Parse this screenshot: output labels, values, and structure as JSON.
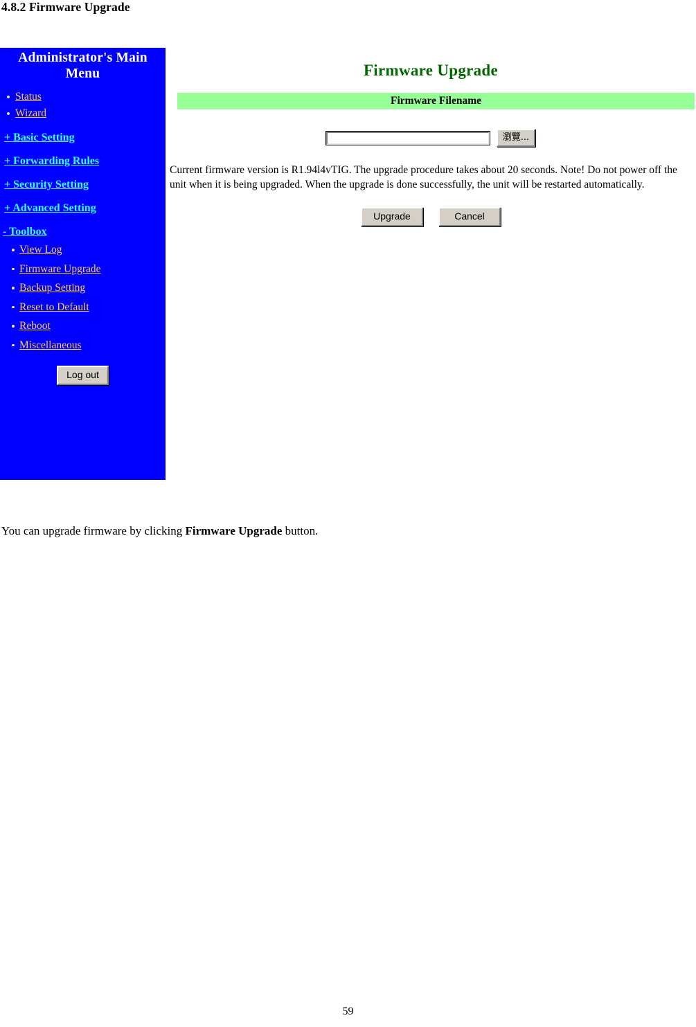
{
  "document": {
    "section_heading": "4.8.2 Firmware Upgrade",
    "caption_prefix": "You can upgrade firmware by clicking ",
    "caption_bold": "Firmware Upgrade",
    "caption_suffix": " button.",
    "page_number": "59"
  },
  "colors": {
    "sidebar_background": "#0000FF",
    "sidebar_link_gold": "#FFCC33",
    "sidebar_link_cyan": "#33FFFF",
    "title_green": "#006600",
    "bar_green": "#99FF99",
    "button_face": "#D4D0C8"
  },
  "sidebar": {
    "title": "Administrator's Main Menu",
    "top_items": [
      {
        "label": "Status"
      },
      {
        "label": "Wizard"
      }
    ],
    "sections": [
      {
        "label": "+ Basic Setting"
      },
      {
        "label": "+ Forwarding Rules"
      },
      {
        "label": "+ Security Setting"
      },
      {
        "label": "+ Advanced Setting"
      }
    ],
    "toolbox": {
      "label": "- Toolbox",
      "items": [
        {
          "label": "View Log"
        },
        {
          "label": "Firmware Upgrade"
        },
        {
          "label": "Backup Setting"
        },
        {
          "label": "Reset to Default"
        },
        {
          "label": "Reboot"
        },
        {
          "label": "Miscellaneous"
        }
      ]
    },
    "logout_label": "Log out"
  },
  "main": {
    "page_title": "Firmware Upgrade",
    "section_bar_label": "Firmware Filename",
    "file_field": {
      "value": "",
      "placeholder": ""
    },
    "browse_label": "瀏覽...",
    "description": "Current firmware version is R1.94l4vTIG. The upgrade procedure takes about 20 seconds. Note! Do not power off the unit when it is being upgraded. When the upgrade is done successfully, the unit will be restarted automatically.",
    "upgrade_label": "Upgrade",
    "cancel_label": "Cancel"
  }
}
